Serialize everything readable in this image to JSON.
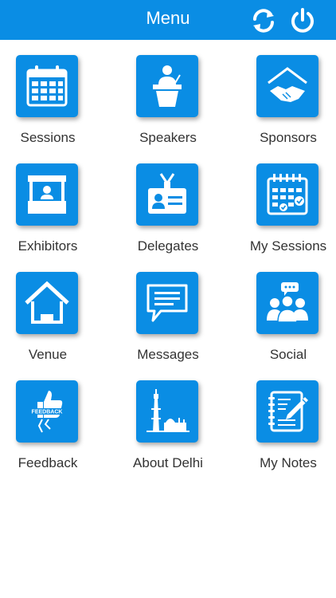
{
  "header": {
    "title": "Menu",
    "refresh_icon": "refresh-icon",
    "power_icon": "power-icon"
  },
  "colors": {
    "header_bg": "#0a8de4",
    "tile_bg": "#0a8de4",
    "label": "#333333"
  },
  "menu": [
    {
      "label": "Sessions",
      "icon": "calendar-icon"
    },
    {
      "label": "Speakers",
      "icon": "podium-speaker-icon"
    },
    {
      "label": "Sponsors",
      "icon": "handshake-icon"
    },
    {
      "label": "Exhibitors",
      "icon": "exhibit-booth-icon"
    },
    {
      "label": "Delegates",
      "icon": "id-badge-icon"
    },
    {
      "label": "My Sessions",
      "icon": "calendar-check-icon"
    },
    {
      "label": "Venue",
      "icon": "house-icon"
    },
    {
      "label": "Messages",
      "icon": "chat-bubble-icon"
    },
    {
      "label": "Social",
      "icon": "people-chat-icon"
    },
    {
      "label": "Feedback",
      "icon": "thumbs-up-feedback-icon"
    },
    {
      "label": "About Delhi",
      "icon": "qutub-minar-icon"
    },
    {
      "label": "My Notes",
      "icon": "notebook-pen-icon"
    }
  ]
}
